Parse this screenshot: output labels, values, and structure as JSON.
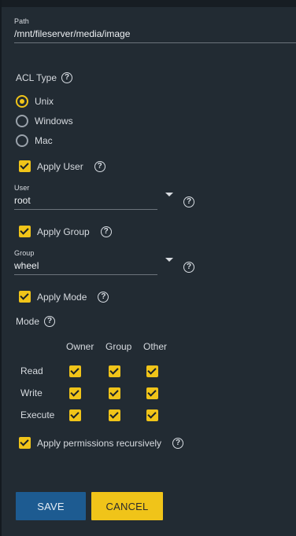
{
  "path": {
    "label": "Path",
    "value": "/mnt/fileserver/media/image"
  },
  "acl_type": {
    "title": "ACL Type",
    "options": [
      {
        "label": "Unix",
        "selected": true
      },
      {
        "label": "Windows",
        "selected": false
      },
      {
        "label": "Mac",
        "selected": false
      }
    ]
  },
  "apply_user": {
    "label": "Apply User",
    "checked": true
  },
  "user": {
    "label": "User",
    "value": "root"
  },
  "apply_group": {
    "label": "Apply Group",
    "checked": true
  },
  "group": {
    "label": "Group",
    "value": "wheel"
  },
  "apply_mode": {
    "label": "Apply Mode",
    "checked": true
  },
  "mode": {
    "title": "Mode",
    "columns": [
      "Owner",
      "Group",
      "Other"
    ],
    "rows": [
      {
        "label": "Read",
        "values": [
          true,
          true,
          true
        ]
      },
      {
        "label": "Write",
        "values": [
          true,
          true,
          true
        ]
      },
      {
        "label": "Execute",
        "values": [
          true,
          true,
          true
        ]
      }
    ]
  },
  "recursive": {
    "label": "Apply permissions recursively",
    "checked": true
  },
  "buttons": {
    "save": "SAVE",
    "cancel": "CANCEL"
  },
  "colors": {
    "accent": "#f0c419",
    "primary": "#1d5b91",
    "background": "#222b33"
  }
}
